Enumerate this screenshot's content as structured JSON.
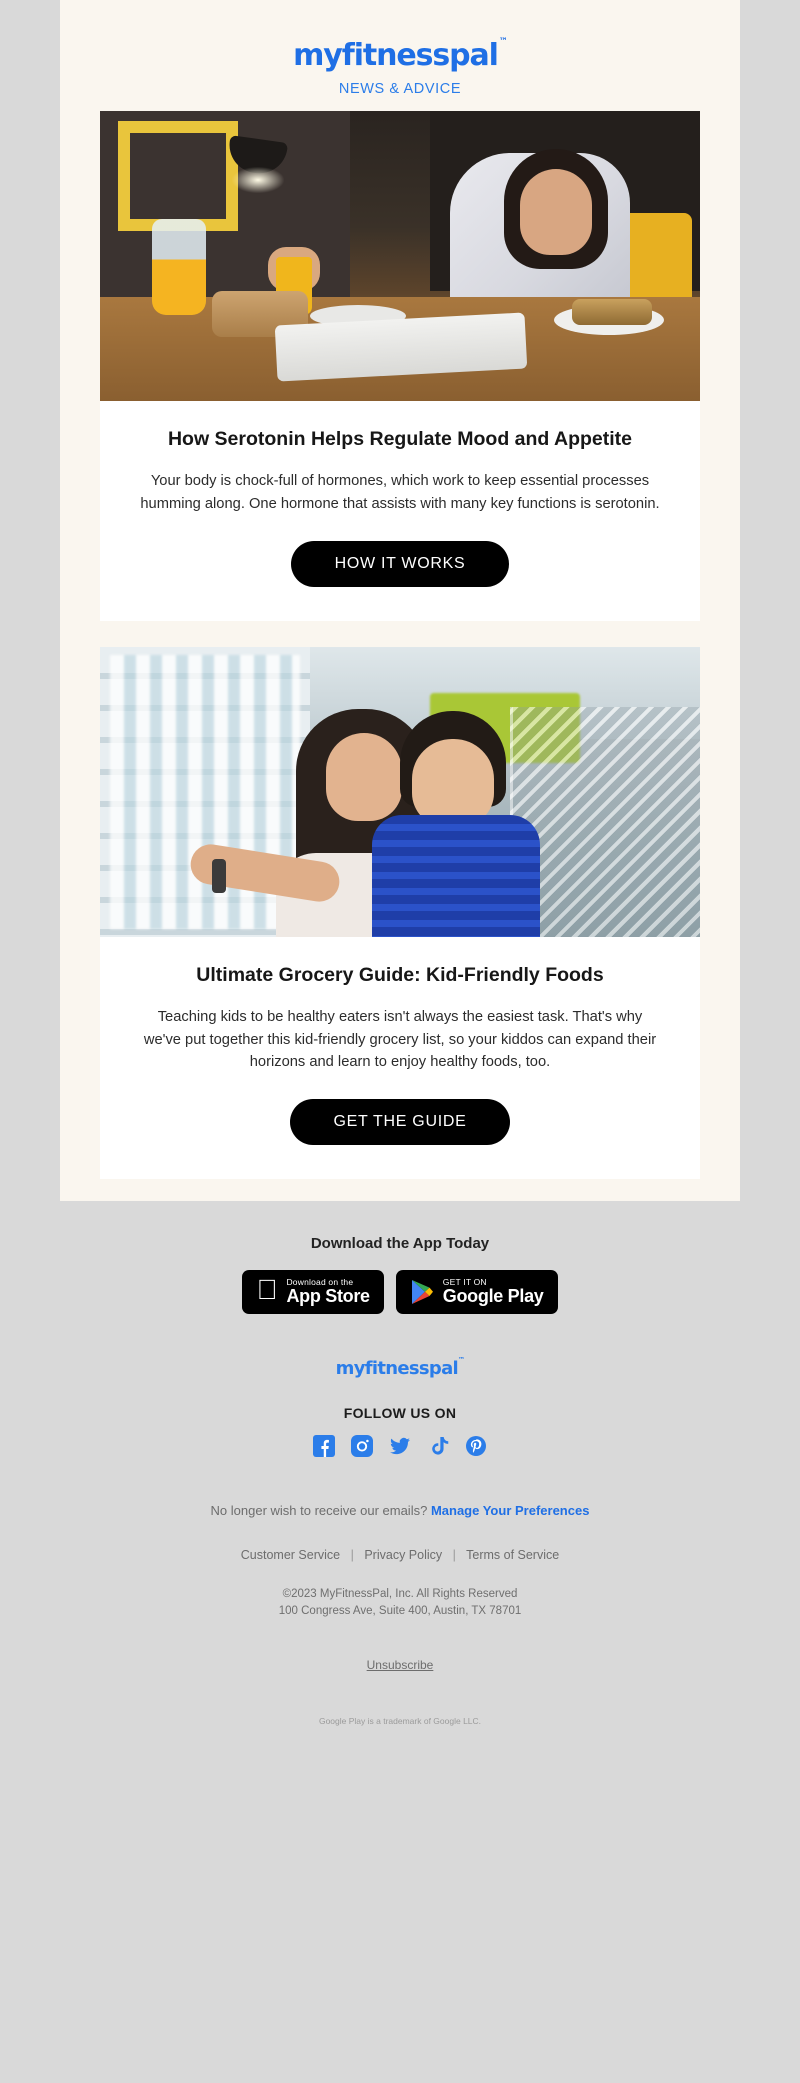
{
  "header": {
    "logo": "myfitnesspal",
    "logo_tm": "™",
    "subhead": "NEWS & ADVICE"
  },
  "articles": [
    {
      "image_alt": "woman-drinking-orange-juice-at-breakfast-table",
      "title": "How Serotonin Helps Regulate Mood and Appetite",
      "body": "Your body is chock-full of hormones, which work to keep essential processes humming along. One hormone that assists with many key functions is serotonin.",
      "cta": "HOW IT WORKS"
    },
    {
      "image_alt": "mother-and-child-shopping-in-grocery-dairy-aisle",
      "title": "Ultimate Grocery Guide: Kid-Friendly Foods",
      "body": "Teaching kids to be healthy eaters isn't always the easiest task. That's why we've put together this kid-friendly grocery list, so your kiddos can expand their horizons and learn to enjoy healthy foods, too.",
      "cta": "GET THE GUIDE"
    }
  ],
  "footer": {
    "download_title": "Download the App Today",
    "app_store": {
      "small": "Download on the",
      "big": "App Store"
    },
    "google_play": {
      "small": "GET IT ON",
      "big": "Google Play"
    },
    "logo": "myfitnesspal",
    "logo_tm": "™",
    "follow_title": "FOLLOW US ON",
    "socials": [
      {
        "name": "facebook",
        "label": "Facebook"
      },
      {
        "name": "instagram",
        "label": "Instagram"
      },
      {
        "name": "twitter",
        "label": "Twitter"
      },
      {
        "name": "tiktok",
        "label": "TikTok"
      },
      {
        "name": "pinterest",
        "label": "Pinterest"
      }
    ],
    "pref_text": "No longer wish to receive our emails?",
    "pref_link": "Manage Your Preferences",
    "links": [
      "Customer Service",
      "Privacy Policy",
      "Terms of Service"
    ],
    "link_sep": "|",
    "copyright_line1": "©2023 MyFitnessPal, Inc. All Rights Reserved",
    "copyright_line2": "100 Congress Ave, Suite 400, Austin, TX 78701",
    "unsubscribe": "Unsubscribe",
    "trademark": "Google Play is a trademark of Google LLC."
  },
  "colors": {
    "brand_blue": "#1f6fe5",
    "subhead_blue": "#2b7de9",
    "cta_bg": "#000000",
    "page_bg": "#d9d9d9",
    "panel_bg": "#faf6ef",
    "card_bg": "#ffffff"
  }
}
